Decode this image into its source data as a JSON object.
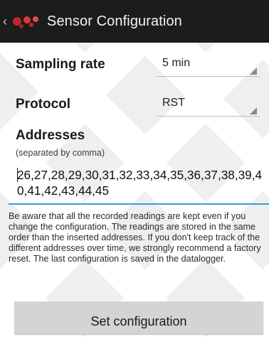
{
  "action_bar": {
    "back_icon": "chevron-left-icon",
    "logo_icon": "libelium-logo-icon",
    "title": "Sensor Configuration",
    "background": "#1c1c1c"
  },
  "sampling_rate": {
    "label": "Sampling rate",
    "value": "5 min"
  },
  "protocol": {
    "label": "Protocol",
    "value": "RST"
  },
  "addresses": {
    "label": "Addresses",
    "hint": "(separated by comma)",
    "value": "26,27,28,29,30,31,32,33,34,35,36,37,38,39,40,41,42,43,44,45",
    "accent": "#3a9fd6"
  },
  "info": {
    "text": "Be aware that all the recorded readings are kept even if you change the configuration. The readings are stored in the same order than the inserted addresses. If you don't keep track of the different addresses over time, we strongly recommend a factory reset. The last configuration is saved in the datalogger."
  },
  "set_button": {
    "label": "Set configuration"
  }
}
